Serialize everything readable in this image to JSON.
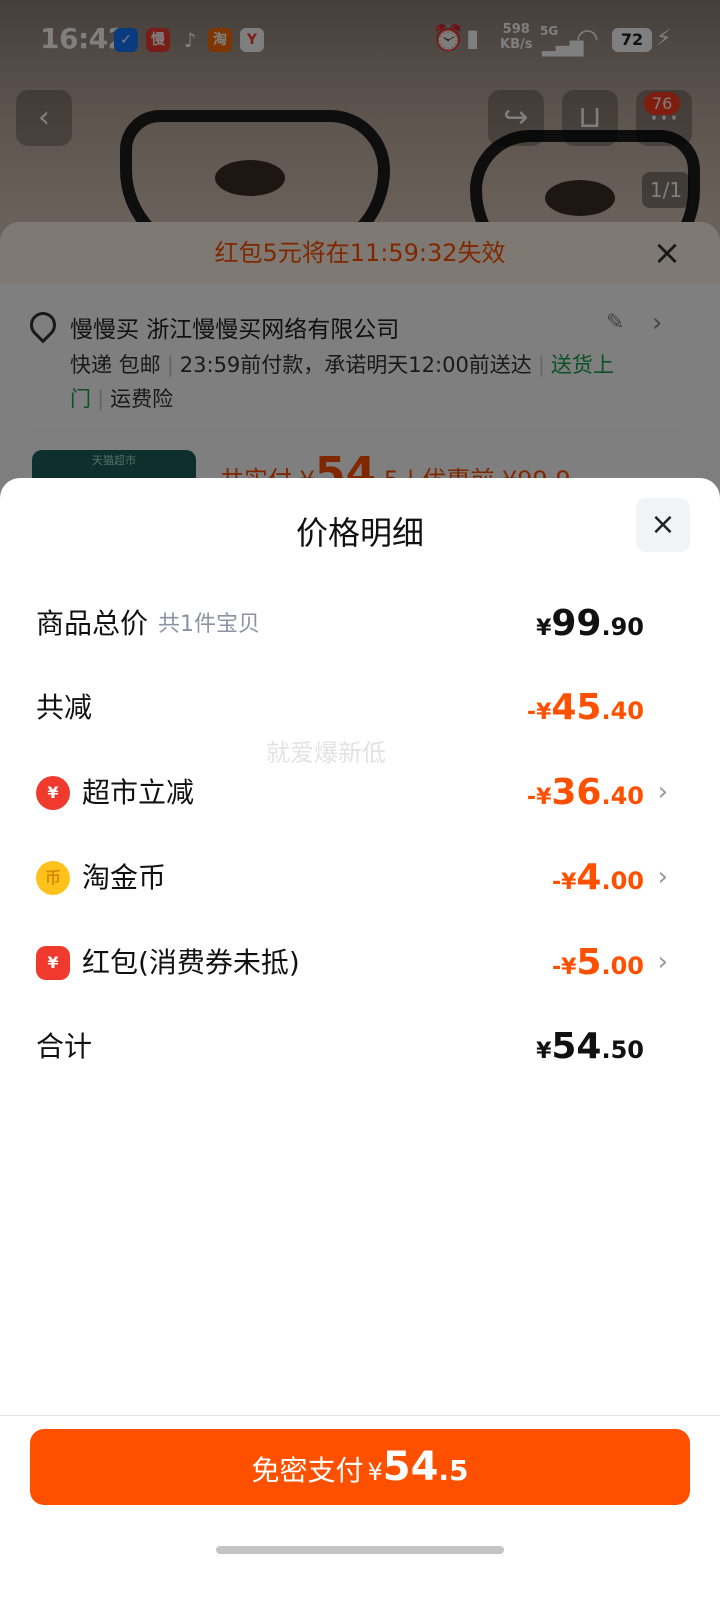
{
  "status_bar": {
    "time": "16:42",
    "net_speed": "598",
    "net_unit": "KB/s",
    "signal": "5G",
    "battery": "72"
  },
  "background": {
    "cart_badge": "76",
    "image_index": "1/1",
    "red_packet_notice": "红包5元将在11:59:32失效",
    "address_name": "慢慢买 浙江慢慢买网络有限公司",
    "ship_express": "快递 包邮",
    "ship_promise": "23:59前付款，承诺明天12:00前送达",
    "ship_door": "送货上门",
    "ship_insurance": "运费险",
    "store_tag": "天猫超市",
    "price_line": "共实付 ¥",
    "price_big": "54",
    "price_tail": ".5 | 优惠前 ¥99.9"
  },
  "sheet": {
    "title": "价格明细",
    "watermark": "就爱爆新低",
    "rows": [
      {
        "label": "商品总价",
        "sub": "共1件宝贝",
        "sign": "",
        "yen": "¥",
        "int": "99",
        "dec": ".90",
        "tone": "dark"
      },
      {
        "label": "共减",
        "sub": "",
        "sign": "-",
        "yen": "¥",
        "int": "45",
        "dec": ".40",
        "tone": "orange"
      },
      {
        "label": "超市立减",
        "icon": "yuan-coin-icon",
        "sign": "-",
        "yen": "¥",
        "int": "36",
        "dec": ".40",
        "tone": "orange"
      },
      {
        "label": "淘金币",
        "icon": "gold-coin-icon",
        "sign": "-",
        "yen": "¥",
        "int": "4",
        "dec": ".00",
        "tone": "orange"
      },
      {
        "label": "红包(消费券未抵)",
        "icon": "red-packet-icon",
        "sign": "-",
        "yen": "¥",
        "int": "5",
        "dec": ".00",
        "tone": "orange"
      },
      {
        "label": "合计",
        "sub": "",
        "sign": "",
        "yen": "¥",
        "int": "54",
        "dec": ".50",
        "tone": "dark"
      }
    ],
    "pay_button": {
      "label": "免密支付",
      "yen": "¥",
      "int": "54",
      "dec": ".5"
    }
  },
  "colors": {
    "accent": "#ff5000",
    "overlay": "rgba(0,0,0,0.5)"
  }
}
